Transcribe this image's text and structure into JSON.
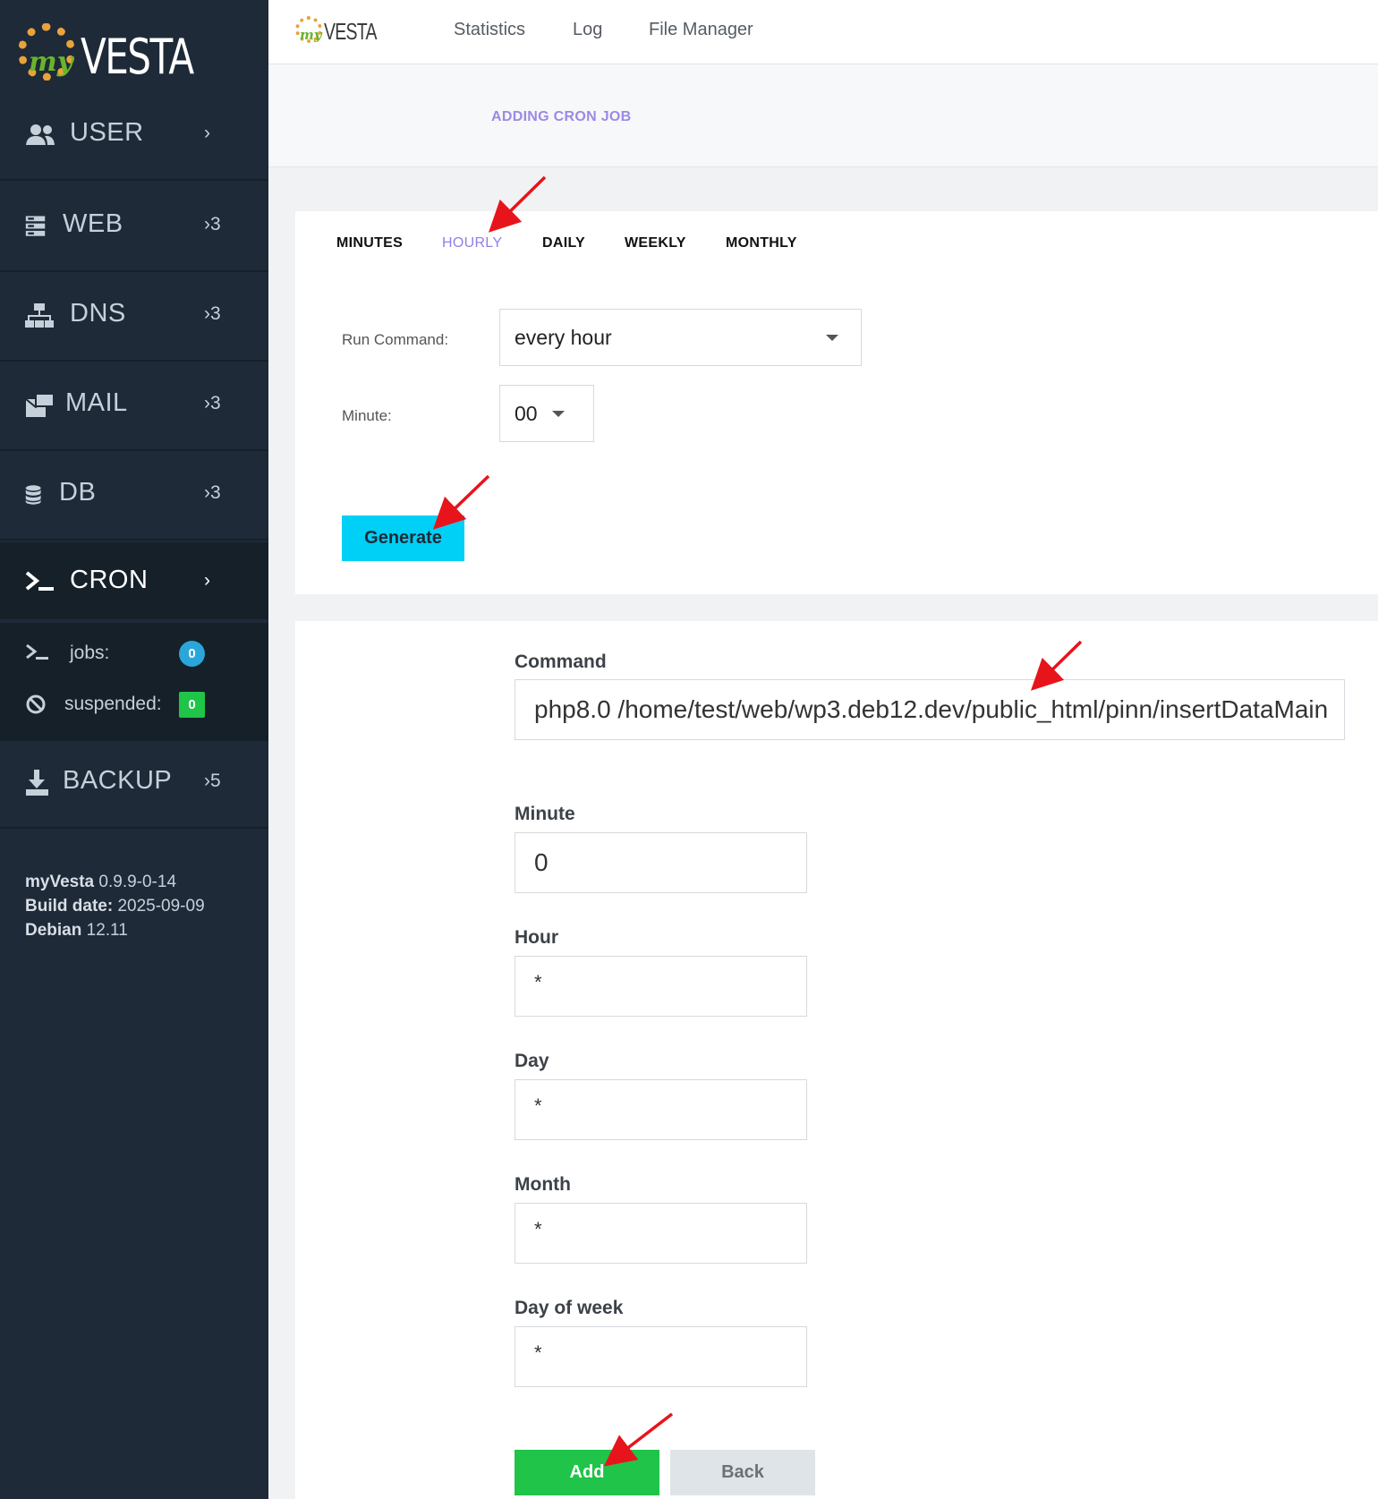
{
  "app": {
    "logo_prefix": "my",
    "logo_word": "VESTA"
  },
  "sidebar": {
    "items": [
      {
        "icon": "users-icon",
        "label": "USER",
        "count": "›"
      },
      {
        "icon": "server-icon",
        "label": "WEB",
        "count": "›3"
      },
      {
        "icon": "network-icon",
        "label": "DNS",
        "count": "›3"
      },
      {
        "icon": "mail-icon",
        "label": "MAIL",
        "count": "›3"
      },
      {
        "icon": "database-icon",
        "label": "DB",
        "count": "›3"
      },
      {
        "icon": "terminal-icon",
        "label": "CRON",
        "count": "›"
      },
      {
        "icon": "download-icon",
        "label": "BACKUP",
        "count": "›5"
      }
    ],
    "cron_stats": {
      "jobs_label": "jobs:",
      "jobs_value": "0",
      "suspended_label": "suspended:",
      "suspended_value": "0"
    },
    "version": {
      "name": "myVesta",
      "version": "0.9.9-0-14",
      "build_label": "Build date:",
      "build_date": "2025-09-09",
      "os": "Debian",
      "os_version": "12.11"
    }
  },
  "topnav": {
    "statistics": "Statistics",
    "log": "Log",
    "file_manager": "File Manager"
  },
  "page": {
    "title": "ADDING CRON JOB"
  },
  "generator": {
    "tabs": [
      "MINUTES",
      "HOURLY",
      "DAILY",
      "WEEKLY",
      "MONTHLY"
    ],
    "active_tab": "HOURLY",
    "run_command_label": "Run Command:",
    "run_command_value": "every hour",
    "minute_label": "Minute:",
    "minute_value": "00",
    "generate_label": "Generate"
  },
  "form": {
    "command_label": "Command",
    "command_value": "php8.0 /home/test/web/wp3.deb12.dev/public_html/pinn/insertDataMain",
    "minute_label": "Minute",
    "minute_value": "0",
    "hour_label": "Hour",
    "hour_value": "*",
    "day_label": "Day",
    "day_value": "*",
    "month_label": "Month",
    "month_value": "*",
    "dow_label": "Day of week",
    "dow_value": "*",
    "add_label": "Add",
    "back_label": "Back"
  },
  "colors": {
    "sidebar_bg": "#1e2a38",
    "accent_purple": "#8f7fe8",
    "generate_cyan": "#00d0f5",
    "add_green": "#1fc449",
    "badge_blue": "#2aa6da",
    "annotation_red": "#e8141b"
  }
}
